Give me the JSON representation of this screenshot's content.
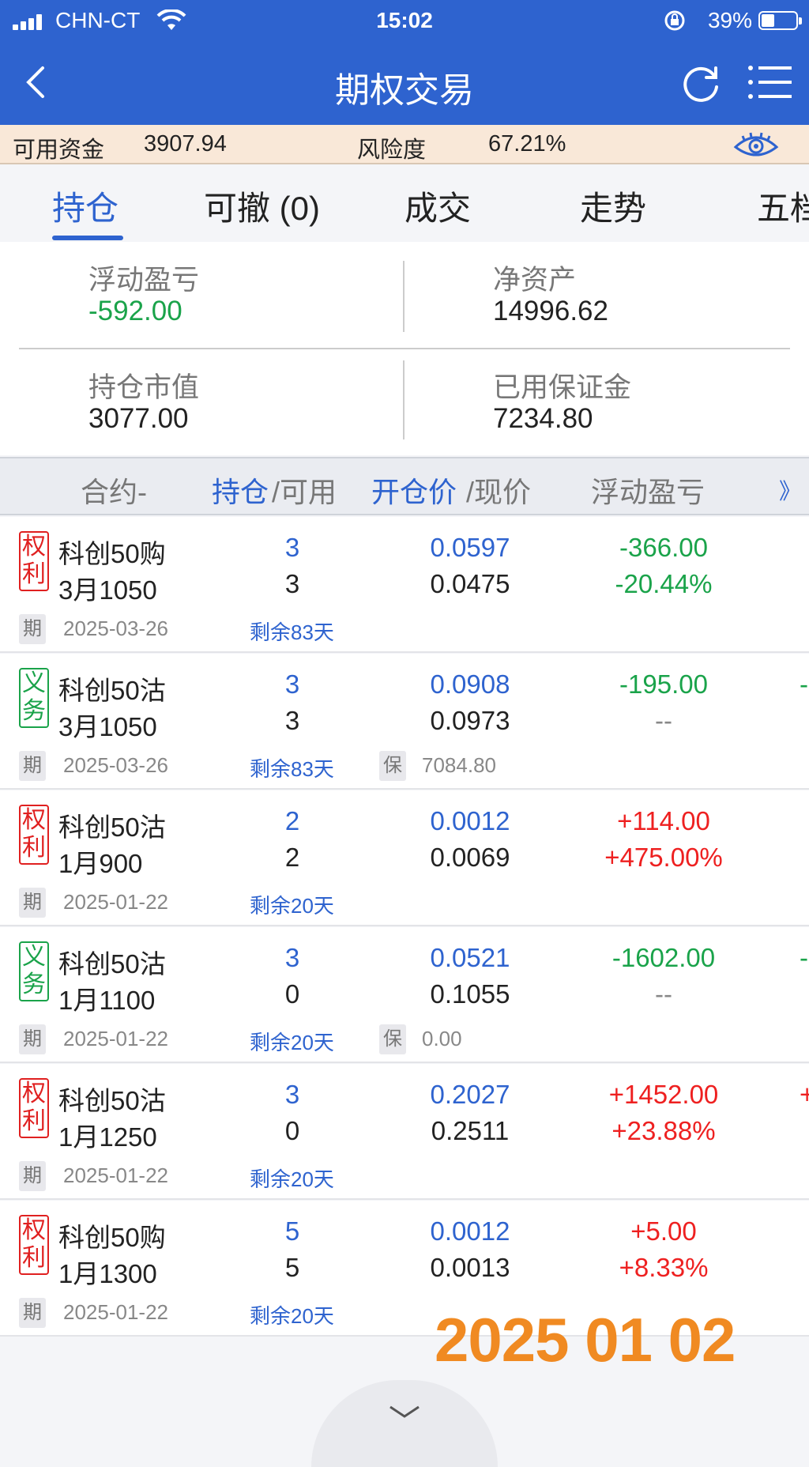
{
  "status_bar": {
    "carrier": "CHN-CT",
    "time": "15:02",
    "battery": "39%"
  },
  "nav": {
    "title": "期权交易"
  },
  "funds": {
    "available_label": "可用资金",
    "available_value": "3907.94",
    "risk_label": "风险度",
    "risk_value": "67.21%"
  },
  "tabs": [
    "持仓",
    "可撤 (0)",
    "成交",
    "走势",
    "五档"
  ],
  "summary": {
    "floating_pnl_label": "浮动盈亏",
    "floating_pnl_value": "-592.00",
    "net_assets_label": "净资产",
    "net_assets_value": "14996.62",
    "market_value_label": "持仓市值",
    "market_value_value": "3077.00",
    "margin_used_label": "已用保证金",
    "margin_used_value": "7234.80"
  },
  "table_header": {
    "contract": "合约-",
    "position": "持仓",
    "available": "/可用",
    "open_price": "开仓价",
    "current_price": "/现价",
    "pnl": "浮动盈亏",
    "more": "》"
  },
  "rows": [
    {
      "type": "权利",
      "name": "科创50购",
      "strike": "3月1050",
      "pos": "3",
      "avail": "3",
      "open": "0.0597",
      "cur": "0.0475",
      "pnl": "-366.00",
      "pnl_pct": "-20.44%",
      "tag": "期",
      "expiry": "2025-03-26",
      "remaining": "剩余83天",
      "margin_tag": "",
      "margin": "",
      "edge": ""
    },
    {
      "type": "义务",
      "name": "科创50沽",
      "strike": "3月1050",
      "pos": "3",
      "avail": "3",
      "open": "0.0908",
      "cur": "0.0973",
      "pnl": "-195.00",
      "pnl_pct": "--",
      "tag": "期",
      "expiry": "2025-03-26",
      "remaining": "剩余83天",
      "margin_tag": "保",
      "margin": "7084.80",
      "edge": "-"
    },
    {
      "type": "权利",
      "name": "科创50沽",
      "strike": "1月900",
      "pos": "2",
      "avail": "2",
      "open": "0.0012",
      "cur": "0.0069",
      "pnl": "+114.00",
      "pnl_pct": "+475.00%",
      "tag": "期",
      "expiry": "2025-01-22",
      "remaining": "剩余20天",
      "margin_tag": "",
      "margin": "",
      "edge": ""
    },
    {
      "type": "义务",
      "name": "科创50沽",
      "strike": "1月1100",
      "pos": "3",
      "avail": "0",
      "open": "0.0521",
      "cur": "0.1055",
      "pnl": "-1602.00",
      "pnl_pct": "--",
      "tag": "期",
      "expiry": "2025-01-22",
      "remaining": "剩余20天",
      "margin_tag": "保",
      "margin": "0.00",
      "edge": "-"
    },
    {
      "type": "权利",
      "name": "科创50沽",
      "strike": "1月1250",
      "pos": "3",
      "avail": "0",
      "open": "0.2027",
      "cur": "0.2511",
      "pnl": "+1452.00",
      "pnl_pct": "+23.88%",
      "tag": "期",
      "expiry": "2025-01-22",
      "remaining": "剩余20天",
      "margin_tag": "",
      "margin": "",
      "edge": "+"
    },
    {
      "type": "权利",
      "name": "科创50购",
      "strike": "1月1300",
      "pos": "5",
      "avail": "5",
      "open": "0.0012",
      "cur": "0.0013",
      "pnl": "+5.00",
      "pnl_pct": "+8.33%",
      "tag": "期",
      "expiry": "2025-01-22",
      "remaining": "剩余20天",
      "margin_tag": "",
      "margin": "",
      "edge": ""
    }
  ],
  "watermark": "2025 01 02",
  "colors": {
    "brand": "#2e63cf",
    "positive": "#ee2020",
    "negative": "#1aa34a",
    "watermark": "#f08a22"
  }
}
